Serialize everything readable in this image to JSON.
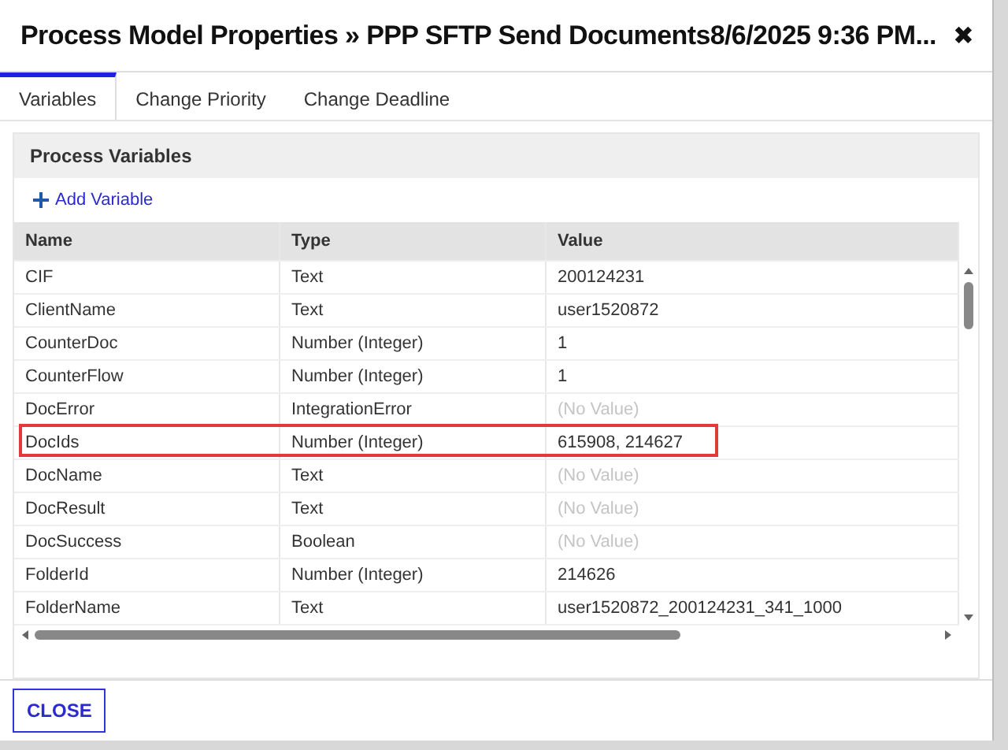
{
  "window": {
    "title": "Process Model Properties » PPP SFTP Send Documents8/6/2025 9:36 PM...",
    "close_icon": "✖"
  },
  "tabs": [
    {
      "label": "Variables",
      "selected": true
    },
    {
      "label": "Change Priority",
      "selected": false
    },
    {
      "label": "Change Deadline",
      "selected": false
    }
  ],
  "panel": {
    "title": "Process Variables",
    "add_button": "Add Variable"
  },
  "table": {
    "columns": [
      "Name",
      "Type",
      "Value"
    ],
    "rows": [
      {
        "name": "CIF",
        "type": "Text",
        "value": "200124231",
        "empty": false,
        "highlighted": false
      },
      {
        "name": "ClientName",
        "type": "Text",
        "value": "user1520872",
        "empty": false,
        "highlighted": false
      },
      {
        "name": "CounterDoc",
        "type": "Number (Integer)",
        "value": "1",
        "empty": false,
        "highlighted": false
      },
      {
        "name": "CounterFlow",
        "type": "Number (Integer)",
        "value": "1",
        "empty": false,
        "highlighted": false
      },
      {
        "name": "DocError",
        "type": "IntegrationError",
        "value": "(No Value)",
        "empty": true,
        "highlighted": false
      },
      {
        "name": "DocIds",
        "type": "Number (Integer)",
        "value": "615908, 214627",
        "empty": false,
        "highlighted": true
      },
      {
        "name": "DocName",
        "type": "Text",
        "value": "(No Value)",
        "empty": true,
        "highlighted": false
      },
      {
        "name": "DocResult",
        "type": "Text",
        "value": "(No Value)",
        "empty": true,
        "highlighted": false
      },
      {
        "name": "DocSuccess",
        "type": "Boolean",
        "value": "(No Value)",
        "empty": true,
        "highlighted": false
      },
      {
        "name": "FolderId",
        "type": "Number (Integer)",
        "value": "214626",
        "empty": false,
        "highlighted": false
      },
      {
        "name": "FolderName",
        "type": "Text",
        "value": "user1520872_200124231_341_1000",
        "empty": false,
        "highlighted": false
      }
    ]
  },
  "footer": {
    "close_button": "CLOSE"
  }
}
